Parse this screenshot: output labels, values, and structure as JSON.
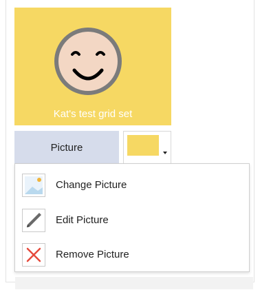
{
  "tile": {
    "caption": "Kat's test grid set",
    "color": "#f6d863",
    "icon": "smiley-face-icon"
  },
  "picture_button": {
    "label": "Picture",
    "color": "#d6dceb"
  },
  "color_picker": {
    "swatch_color": "#f6d863",
    "icon": "chevron-down-icon"
  },
  "menu": {
    "items": [
      {
        "label": "Change Picture",
        "icon": "image-icon"
      },
      {
        "label": "Edit Picture",
        "icon": "pencil-icon"
      },
      {
        "label": "Remove Picture",
        "icon": "close-icon"
      }
    ]
  }
}
